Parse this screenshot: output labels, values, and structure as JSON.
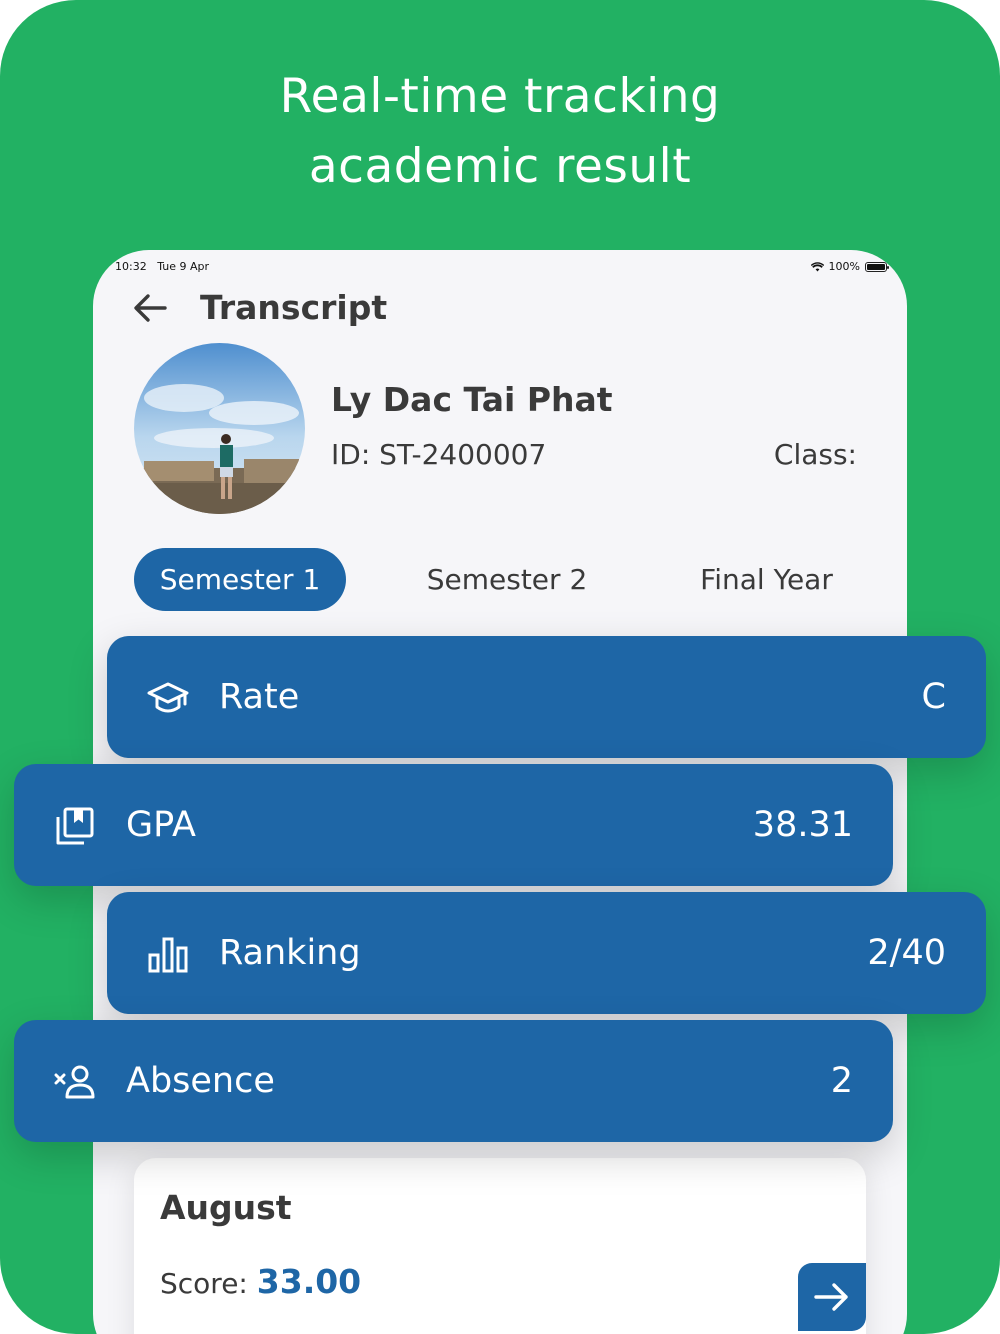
{
  "headline": {
    "line1": "Real-time tracking",
    "line2": "academic result"
  },
  "status_bar": {
    "time": "10:32",
    "date": "Tue 9 Apr",
    "battery": "100%"
  },
  "header": {
    "title": "Transcript"
  },
  "student": {
    "name": "Ly Dac Tai Phat",
    "id": "ID: ST-2400007",
    "class": "Class:"
  },
  "tabs": [
    {
      "label": "Semester 1",
      "active": true
    },
    {
      "label": "Semester 2",
      "active": false
    },
    {
      "label": "Final Year",
      "active": false
    }
  ],
  "stats": {
    "rate": {
      "label": "Rate",
      "value": "C",
      "icon": "graduation-cap-icon"
    },
    "gpa": {
      "label": "GPA",
      "value": "38.31",
      "icon": "bookmark-stack-icon"
    },
    "ranking": {
      "label": "Ranking",
      "value": "2/40",
      "icon": "bar-chart-icon"
    },
    "absence": {
      "label": "Absence",
      "value": "2",
      "icon": "person-remove-icon"
    }
  },
  "month_card": {
    "month": "August",
    "score_label": "Score: ",
    "score_value": "33.00"
  },
  "colors": {
    "green": "#22b163",
    "blue": "#1e66a6",
    "text": "#3a3a3a"
  }
}
